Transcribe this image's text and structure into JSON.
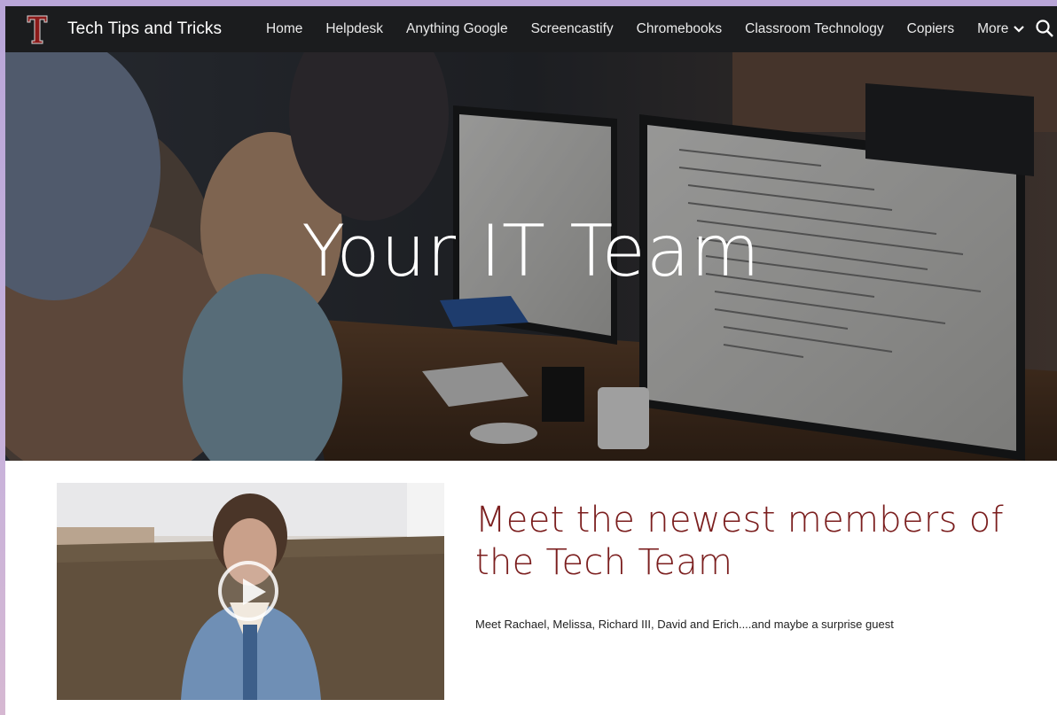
{
  "site": {
    "title": "Tech Tips and Tricks",
    "logo_letter": "T",
    "brand_color": "#8b1a1a",
    "header_bg": "#1b1c1e"
  },
  "nav": {
    "items": [
      {
        "label": "Home"
      },
      {
        "label": "Helpdesk"
      },
      {
        "label": "Anything Google"
      },
      {
        "label": "Screencastify"
      },
      {
        "label": "Chromebooks"
      },
      {
        "label": "Classroom Technology"
      },
      {
        "label": "Copiers"
      }
    ],
    "more_label": "More",
    "more_icon": "chevron-down-icon",
    "search_icon": "search-icon"
  },
  "hero": {
    "title": "Your IT Team"
  },
  "feature": {
    "heading": "Meet the newest members of the Tech Team",
    "description": "Meet Rachael, Melissa, Richard III, David and Erich....and maybe a surprise guest",
    "video_icon": "play-icon",
    "heading_color": "#7b1e1e"
  }
}
